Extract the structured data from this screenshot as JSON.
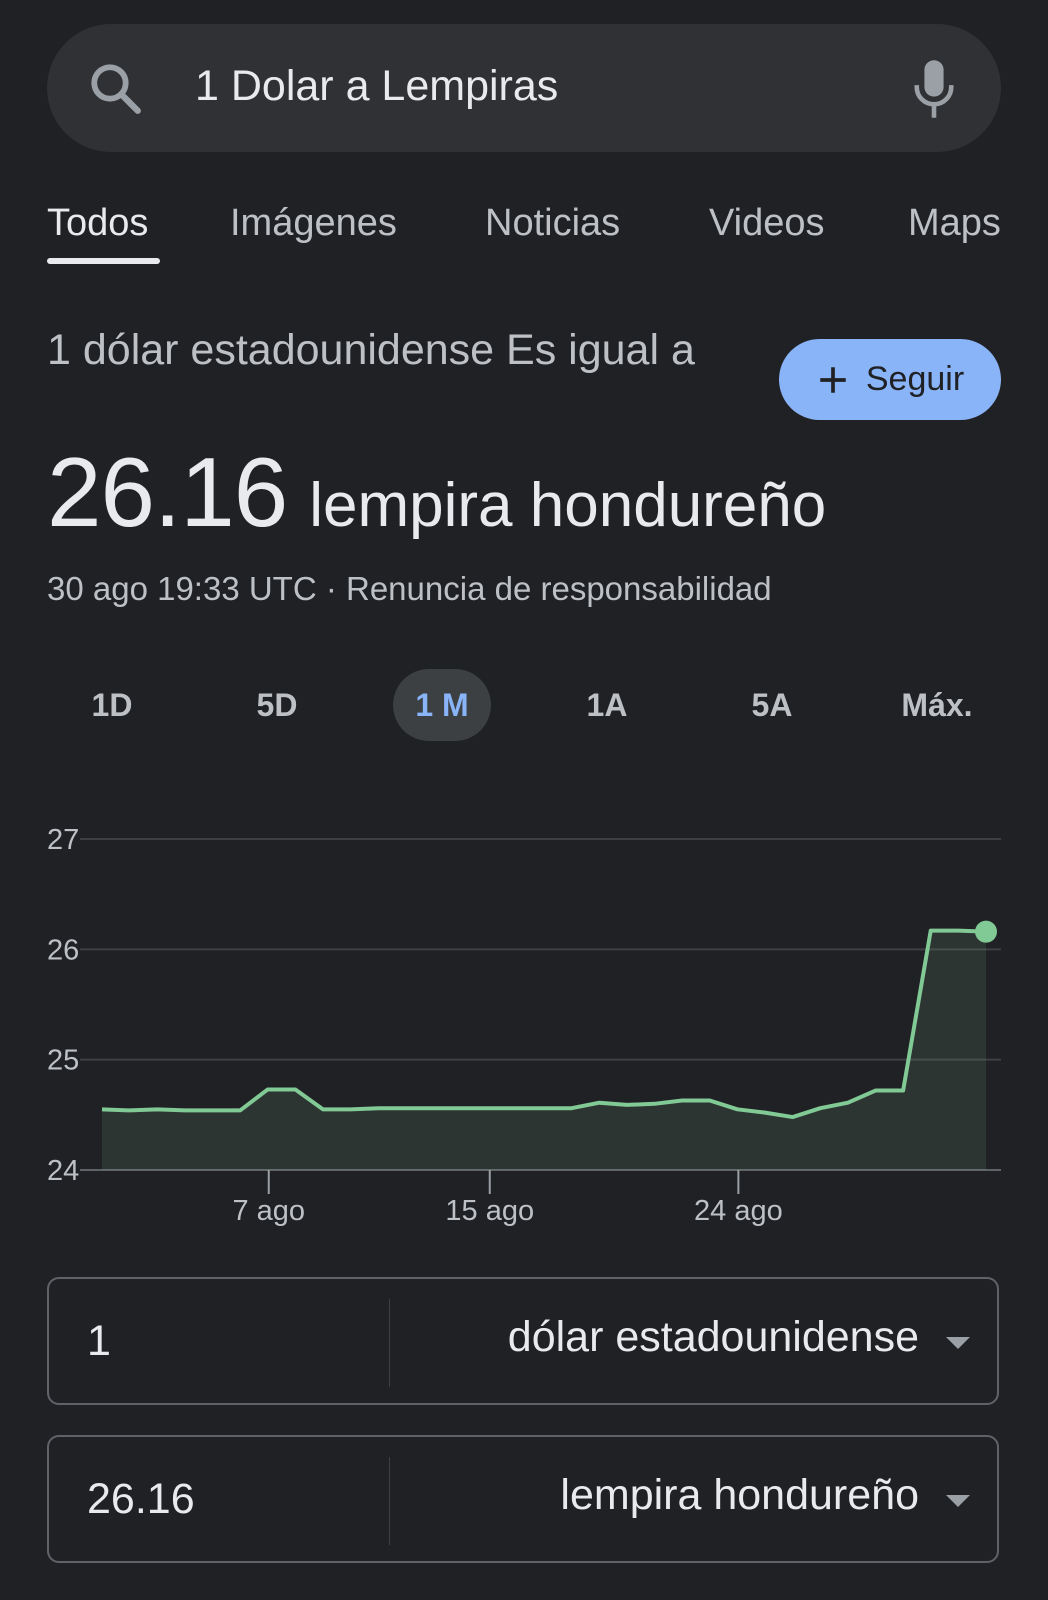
{
  "search": {
    "query": "1 Dolar a Lempiras"
  },
  "tabs": [
    {
      "label": "Todos",
      "active": true
    },
    {
      "label": "Imágenes",
      "active": false
    },
    {
      "label": "Noticias",
      "active": false
    },
    {
      "label": "Videos",
      "active": false
    },
    {
      "label": "Maps",
      "active": false
    }
  ],
  "result": {
    "equals_text": "1 dólar estadounidense Es igual a",
    "rate": "26.16",
    "currency": "lempira hondureño",
    "timestamp": "30 ago 19:33 UTC",
    "separator": " · ",
    "disclaimer": "Renuncia de responsabilidad",
    "follow_label": "Seguir"
  },
  "ranges": [
    {
      "label": "1D",
      "active": false
    },
    {
      "label": "5D",
      "active": false
    },
    {
      "label": "1 M",
      "active": true
    },
    {
      "label": "1A",
      "active": false
    },
    {
      "label": "5A",
      "active": false
    },
    {
      "label": "Máx.",
      "active": false
    }
  ],
  "chart_data": {
    "type": "area",
    "title": "",
    "xlabel": "",
    "ylabel": "",
    "ylim": [
      24,
      27
    ],
    "yticks": [
      "27",
      "26",
      "25",
      "24"
    ],
    "xticks": [
      {
        "label": "7 ago",
        "index": 7
      },
      {
        "label": "15 ago",
        "index": 15
      },
      {
        "label": "24 ago",
        "index": 24
      }
    ],
    "grid": true,
    "series": [
      {
        "values": [
          24.55,
          24.54,
          24.55,
          24.54,
          24.54,
          24.54,
          24.73,
          24.73,
          24.55,
          24.55,
          24.56,
          24.56,
          24.56,
          24.56,
          24.56,
          24.56,
          24.56,
          24.56,
          24.61,
          24.59,
          24.6,
          24.63,
          24.63,
          24.55,
          24.52,
          24.48,
          24.56,
          24.61,
          24.72,
          24.72,
          26.17,
          26.17,
          26.16
        ]
      }
    ],
    "colors": {
      "line": "#81c995",
      "fill": "#81c995",
      "grid": "#3c4043",
      "text": "#bdc1c6"
    }
  },
  "converter": {
    "from_amount": "1",
    "from_currency": "dólar estadounidense",
    "to_amount": "26.16",
    "to_currency": "lempira hondureño"
  },
  "colors": {
    "background": "#202124",
    "surface": "#303134",
    "accent": "#8ab4f8",
    "positive": "#81c995"
  }
}
